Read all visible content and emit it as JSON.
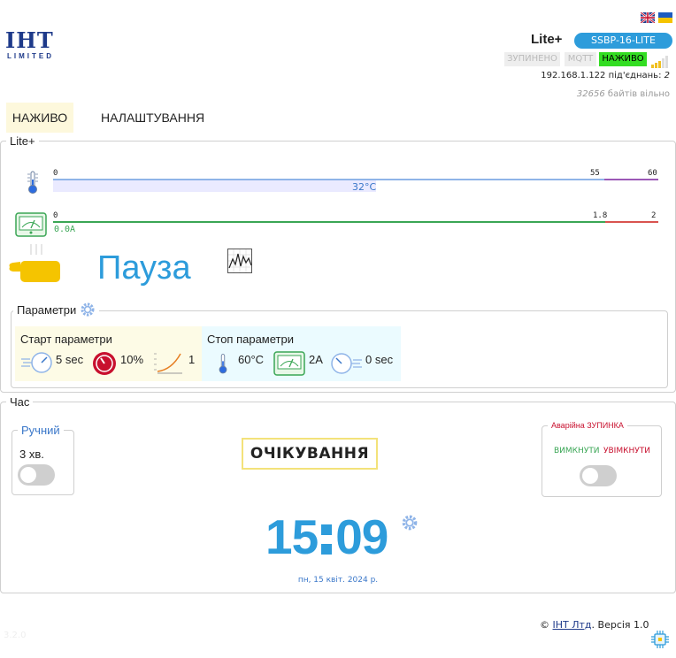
{
  "header": {
    "brand_logo_text": "IHT",
    "brand_logo_sub": "LIMITED",
    "device_name": "Lite+",
    "model": "SSBP-16-LITE",
    "status": {
      "stopped": "ЗУПИНЕНО",
      "mqtt": "MQTT",
      "live": "НАЖИВО"
    },
    "ip_line": "192.168.1.122 під'єднань: ",
    "connections": "2",
    "free_bytes": "32656",
    "free_label": " байтів вільно",
    "languages": [
      "en",
      "uk"
    ]
  },
  "tabs": [
    {
      "label": "НАЖИВО",
      "active": true
    },
    {
      "label": "НАЛАШТУВАННЯ",
      "active": false
    }
  ],
  "device_panel": {
    "legend": "Lite+",
    "temperature": {
      "min": "0",
      "warn": "55",
      "max": "60",
      "value_label": "32°C",
      "value": 32,
      "range": [
        0,
        60
      ],
      "warn_at": 55
    },
    "current": {
      "min": "0",
      "warn": "1.8",
      "max": "2",
      "value_label": "0.0A",
      "value": 0.0,
      "range": [
        0,
        2
      ],
      "warn_at": 1.8
    },
    "state": "Пауза",
    "params": {
      "legend": "Параметри",
      "start": {
        "title": "Старт параметри",
        "time": "5 sec",
        "power": "10%",
        "ramp": "1"
      },
      "stop": {
        "title": "Стоп параметри",
        "temp": "60°C",
        "current": "2A",
        "time": "0 sec"
      }
    }
  },
  "time_panel": {
    "legend": "Час",
    "manual": {
      "title": "Ручний",
      "duration": "3 хв.",
      "enabled": false
    },
    "status_box": "ОЧІКУВАННЯ",
    "emergency": {
      "title": "Аварійна ЗУПИНКА",
      "off_label": "ВИМКНУТИ",
      "on_label": "УВІМКНУТИ",
      "enabled": false
    },
    "clock_hh": "15",
    "clock_mm": "09",
    "date": "пн, 15 квіт. 2024 р."
  },
  "footer": {
    "copyright": "©",
    "company_link": "IHT Лтд",
    "version_text": ". Версія 1.0",
    "build": "3.2.0"
  },
  "colors": {
    "accent_blue": "#2d9cdb",
    "live_green": "#33dd22",
    "temp_bar": "#8fb4e8",
    "temp_warn": "#9b59b6",
    "current_bar": "#3aa655",
    "current_warn": "#d9534f",
    "tab_active_bg": "#fdf8dc"
  }
}
